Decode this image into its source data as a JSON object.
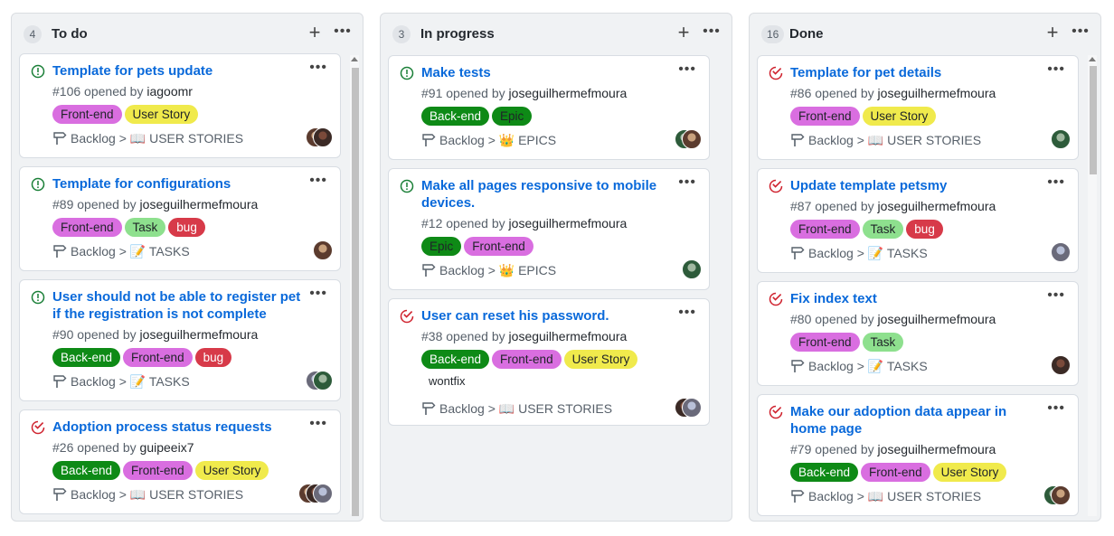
{
  "colors": {
    "front_end": "#d96ee0",
    "user_story": "#f0ea4c",
    "back_end": "#0e8a16",
    "epic": "#0e8a16",
    "task": "#8ee08e",
    "bug": "#d73a49",
    "open_icon": "#1a7f37",
    "closed_icon": "#cf222e",
    "link": "#0969da"
  },
  "columns": [
    {
      "count": "4",
      "title": "To do",
      "cards": [
        {
          "title": "Template for pets update",
          "number": "#106",
          "opened_by": "opened by",
          "author": "iagoomr",
          "status": "open",
          "labels": [
            "Front-end",
            "User Story"
          ],
          "project": "Backlog > 📖 USER STORIES",
          "avatar_icon": "user-avatar-icon"
        },
        {
          "title": "Template for configurations",
          "number": "#89",
          "opened_by": "opened by",
          "author": "joseguilhermefmoura",
          "status": "open",
          "labels": [
            "Front-end",
            "Task",
            "bug"
          ],
          "project": "Backlog > 📝 TASKS",
          "avatar_icon": "user-avatar-icon"
        },
        {
          "title": "User should not be able to register pet if the registration is not complete",
          "number": "#90",
          "opened_by": "opened by",
          "author": "joseguilhermefmoura",
          "status": "open",
          "labels": [
            "Back-end",
            "Front-end",
            "bug"
          ],
          "project": "Backlog > 📝 TASKS",
          "avatar_icon": "user-avatar-icon"
        },
        {
          "title": "Adoption process status requests",
          "number": "#26",
          "opened_by": "opened by",
          "author": "guipeeix7",
          "status": "closed",
          "labels": [
            "Back-end",
            "Front-end",
            "User Story"
          ],
          "project": "Backlog > 📖 USER STORIES",
          "avatar_icon": "user-avatar-icon"
        }
      ]
    },
    {
      "count": "3",
      "title": "In progress",
      "cards": [
        {
          "title": "Make tests",
          "number": "#91",
          "opened_by": "opened by",
          "author": "joseguilhermefmoura",
          "status": "open",
          "labels": [
            "Back-end",
            "Epic"
          ],
          "project": "Backlog > 👑 EPICS",
          "avatar_icon": "user-avatar-icon"
        },
        {
          "title": "Make all pages responsive to mobile devices.",
          "number": "#12",
          "opened_by": "opened by",
          "author": "joseguilhermefmoura",
          "status": "open",
          "labels": [
            "Epic",
            "Front-end"
          ],
          "project": "Backlog > 👑 EPICS",
          "avatar_icon": "user-avatar-icon"
        },
        {
          "title": "User can reset his password.",
          "number": "#38",
          "opened_by": "opened by",
          "author": "joseguilhermefmoura",
          "status": "closed",
          "labels": [
            "Back-end",
            "Front-end",
            "User Story"
          ],
          "extra_label": "wontfix",
          "project": "Backlog > 📖 USER STORIES",
          "avatar_icon": "user-avatar-icon"
        }
      ]
    },
    {
      "count": "16",
      "title": "Done",
      "cards": [
        {
          "title": "Template for pet details",
          "number": "#86",
          "opened_by": "opened by",
          "author": "joseguilhermefmoura",
          "status": "closed",
          "labels": [
            "Front-end",
            "User Story"
          ],
          "project": "Backlog > 📖 USER STORIES",
          "avatar_icon": "user-avatar-icon"
        },
        {
          "title": "Update template petsmy",
          "number": "#87",
          "opened_by": "opened by",
          "author": "joseguilhermefmoura",
          "status": "closed",
          "labels": [
            "Front-end",
            "Task",
            "bug"
          ],
          "project": "Backlog > 📝 TASKS",
          "avatar_icon": "user-avatar-icon"
        },
        {
          "title": "Fix index text",
          "number": "#80",
          "opened_by": "opened by",
          "author": "joseguilhermefmoura",
          "status": "closed",
          "labels": [
            "Front-end",
            "Task"
          ],
          "project": "Backlog > 📝 TASKS",
          "avatar_icon": "user-avatar-icon"
        },
        {
          "title": "Make our adoption data appear in home page",
          "number": "#79",
          "opened_by": "opened by",
          "author": "joseguilhermefmoura",
          "status": "closed",
          "labels": [
            "Back-end",
            "Front-end",
            "User Story"
          ],
          "project": "Backlog > 📖 USER STORIES",
          "avatar_icon": "user-avatar-icon"
        }
      ]
    }
  ]
}
